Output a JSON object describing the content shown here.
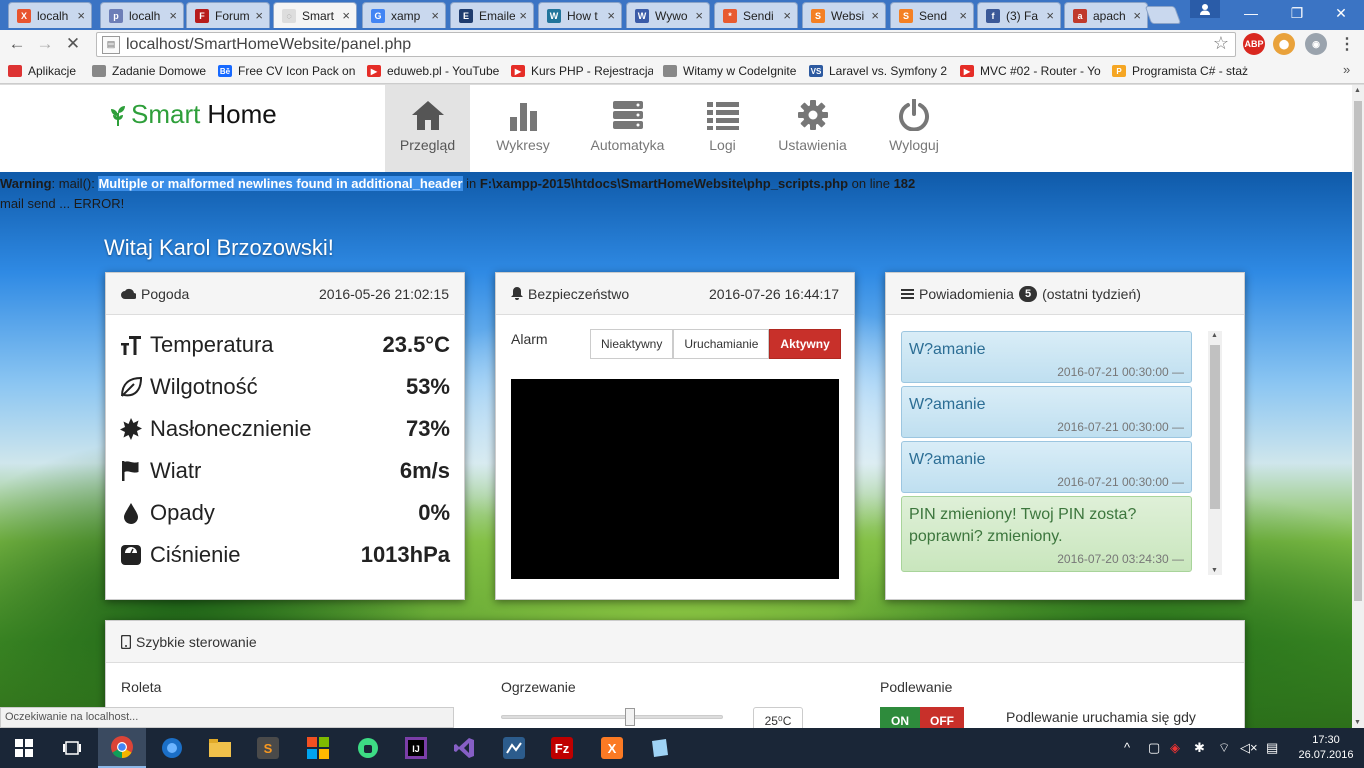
{
  "browser": {
    "tabs": [
      {
        "label": "localh",
        "icon": "xampp-icon",
        "color": "#e8542f",
        "glyph": "X"
      },
      {
        "label": "localh",
        "icon": "php-myadmin-icon",
        "color": "#6c7eb7",
        "glyph": "p"
      },
      {
        "label": "Forum",
        "icon": "forum-icon",
        "color": "#b71c1c",
        "glyph": "F"
      },
      {
        "label": "Smart",
        "icon": "loading-spinner-icon",
        "color": "#dddddd",
        "glyph": "◌",
        "active": true
      },
      {
        "label": "xamp",
        "icon": "google-icon",
        "color": "#4285f4",
        "glyph": "G"
      },
      {
        "label": "Emaile",
        "icon": "email-icon",
        "color": "#1f3c6e",
        "glyph": "E"
      },
      {
        "label": "How t",
        "icon": "wordpress-icon",
        "color": "#21759b",
        "glyph": "W"
      },
      {
        "label": "Wywo",
        "icon": "bookmark-icon",
        "color": "#3a5ba8",
        "glyph": "W"
      },
      {
        "label": "Sendi",
        "icon": "asterisk-icon",
        "color": "#e85a2f",
        "glyph": "*"
      },
      {
        "label": "Websi",
        "icon": "stackoverflow-icon",
        "color": "#f48024",
        "glyph": "S"
      },
      {
        "label": "Send",
        "icon": "stackoverflow-icon",
        "color": "#f48024",
        "glyph": "S"
      },
      {
        "label": "(3) Fa",
        "icon": "facebook-icon",
        "color": "#3b5998",
        "glyph": "f"
      },
      {
        "label": "apach",
        "icon": "apache-icon",
        "color": "#c0392b",
        "glyph": "a"
      }
    ],
    "url": "localhost/SmartHomeWebsite/panel.php",
    "bookmarks": [
      {
        "label": "Aplikacje",
        "icon": "apps-grid-icon",
        "color": "#d33"
      },
      {
        "label": "Zadanie Domowe",
        "icon": "page-icon",
        "color": "#888"
      },
      {
        "label": "Free CV Icon Pack on",
        "icon": "behance-icon",
        "color": "#1769ff",
        "glyph": "Bē"
      },
      {
        "label": "eduweb.pl - YouTube",
        "icon": "youtube-icon",
        "color": "#e52d27",
        "glyph": "▶"
      },
      {
        "label": "Kurs PHP - Rejestracja",
        "icon": "youtube-icon",
        "color": "#e52d27",
        "glyph": "▶"
      },
      {
        "label": "Witamy w CodeIgnite",
        "icon": "page-icon",
        "color": "#888"
      },
      {
        "label": "Laravel vs. Symfony 2",
        "icon": "vs-icon",
        "color": "#2d5aa0",
        "glyph": "VS"
      },
      {
        "label": "MVC #02 - Router - Yo",
        "icon": "youtube-icon",
        "color": "#e52d27",
        "glyph": "▶"
      },
      {
        "label": "Programista C# - staż",
        "icon": "programista-icon",
        "color": "#f5a623",
        "glyph": "P"
      }
    ],
    "status_text": "Oczekiwanie na localhost..."
  },
  "site": {
    "brand": {
      "part1": "Smart",
      "part2": "Home"
    },
    "nav": [
      {
        "label": "Przegląd",
        "icon": "home-icon",
        "active": true
      },
      {
        "label": "Wykresy",
        "icon": "bar-chart-icon"
      },
      {
        "label": "Automatyka",
        "icon": "server-icon"
      },
      {
        "label": "Logi",
        "icon": "list-icon"
      },
      {
        "label": "Ustawienia",
        "icon": "gear-icon"
      },
      {
        "label": "Wyloguj",
        "icon": "power-icon"
      }
    ],
    "warning": {
      "prefix": "Warning",
      "fn": ": mail(): ",
      "msg": "Multiple or malformed newlines found in additional_header",
      "in": " in ",
      "path": "F:\\xampp-2015\\htdocs\\SmartHomeWebsite\\php_scripts.php",
      "online": " on line ",
      "line": "182"
    },
    "mail_error": "mail send ... ERROR!",
    "greeting": "Witaj Karol Brzozowski!"
  },
  "weather": {
    "title": "Pogoda",
    "date": "2016-05-26 21:02:15",
    "rows": [
      {
        "label": "Temperatura",
        "value": "23.5°C",
        "icon": "temperature-icon"
      },
      {
        "label": "Wilgotność",
        "value": "53%",
        "icon": "leaf-icon"
      },
      {
        "label": "Nasłonecznienie",
        "value": "73%",
        "icon": "sun-icon"
      },
      {
        "label": "Wiatr",
        "value": "6m/s",
        "icon": "flag-icon"
      },
      {
        "label": "Opady",
        "value": "0%",
        "icon": "drop-icon"
      },
      {
        "label": "Ciśnienie",
        "value": "1013hPa",
        "icon": "scale-icon"
      }
    ]
  },
  "security": {
    "title": "Bezpieczeństwo",
    "date": "2016-07-26 16:44:17",
    "alarm_label": "Alarm",
    "states": [
      "Nieaktywny",
      "Uruchamianie",
      "Aktywny"
    ],
    "active_state": "Aktywny"
  },
  "notifications": {
    "title": "Powiadomienia",
    "count": "5",
    "suffix": "(ostatni tydzień)",
    "items": [
      {
        "text": "W?amanie",
        "date": "2016-07-21 00:30:00 —",
        "type": "info"
      },
      {
        "text": "W?amanie",
        "date": "2016-07-21 00:30:00 —",
        "type": "info"
      },
      {
        "text": "W?amanie",
        "date": "2016-07-21 00:30:00 —",
        "type": "info"
      },
      {
        "text": "PIN zmieniony! Twoj PIN zosta? poprawni? zmieniony.",
        "date": "2016-07-20 03:24:30 —",
        "type": "success"
      }
    ]
  },
  "quick": {
    "title": "Szybkie sterowanie",
    "roleta": "Roleta",
    "ogrzewanie": "Ogrzewanie",
    "temp": "25⁰C",
    "heating_level": 0.58,
    "podlewanie": "Podlewanie",
    "on": "ON",
    "off": "OFF",
    "desc": "Podlewanie uruchamia się gdy"
  },
  "taskbar": {
    "time": "17:30",
    "date": "26.07.2016"
  },
  "colors": {
    "brand_green": "#2e9f3a",
    "alarm_active": "#c8302a",
    "info_bg": "#d9edf7",
    "success_bg": "#dff0d8"
  }
}
